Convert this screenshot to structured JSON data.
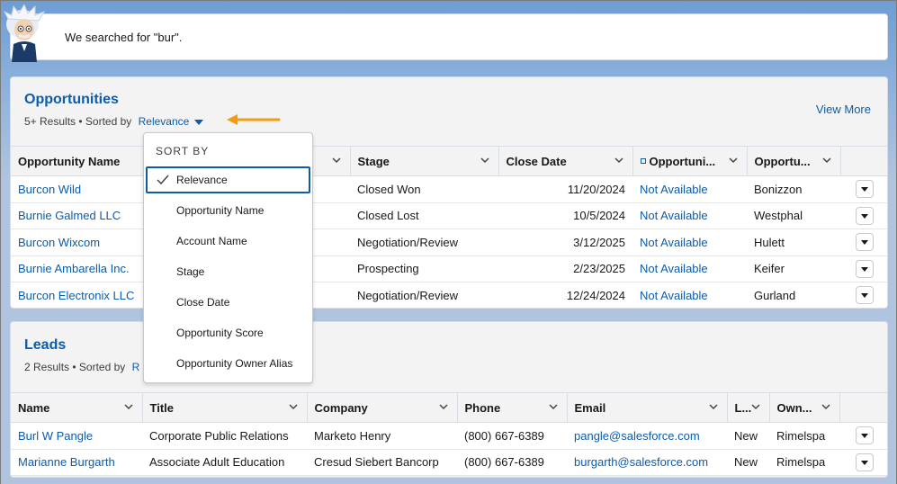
{
  "banner": {
    "text": "We searched for \"bur\"."
  },
  "opportunities": {
    "title": "Opportunities",
    "meta_prefix": "5+ Results • Sorted by",
    "sort_value": "Relevance",
    "view_more": "View More",
    "columns": [
      "Opportunity Name",
      "",
      "Stage",
      "Close Date",
      "Opportuni...",
      "Opportu..."
    ],
    "rows": [
      {
        "name": "Burcon Wild",
        "stage": "Closed Won",
        "close_date": "11/20/2024",
        "score": "Not Available",
        "owner": "Bonizzon"
      },
      {
        "name": "Burnie Galmed LLC",
        "stage": "Closed Lost",
        "close_date": "10/5/2024",
        "score": "Not Available",
        "owner": "Westphal"
      },
      {
        "name": "Burcon Wixcom",
        "stage": "Negotiation/Review",
        "close_date": "3/12/2025",
        "score": "Not Available",
        "owner": "Hulett"
      },
      {
        "name": "Burnie Ambarella Inc.",
        "stage": "Prospecting",
        "close_date": "2/23/2025",
        "score": "Not Available",
        "owner": "Keifer"
      },
      {
        "name": "Burcon Electronix LLC",
        "stage": "Negotiation/Review",
        "close_date": "12/24/2024",
        "score": "Not Available",
        "owner": "Gurland"
      }
    ]
  },
  "leads": {
    "title": "Leads",
    "meta_prefix": "2 Results • Sorted by",
    "sort_value": "R",
    "columns": [
      "Name",
      "Title",
      "Company",
      "Phone",
      "Email",
      "L...",
      "Own..."
    ],
    "rows": [
      {
        "name": "Burl W Pangle",
        "title": "Corporate Public Relations",
        "company": "Marketo Henry",
        "phone": "(800) 667-6389",
        "email": "pangle@salesforce.com",
        "status": "New",
        "owner": "Rimelspa"
      },
      {
        "name": "Marianne Burgarth",
        "title": "Associate Adult Education",
        "company": "Cresud Siebert Bancorp",
        "phone": "(800) 667-6389",
        "email": "burgarth@salesforce.com",
        "status": "New",
        "owner": "Rimelspa"
      }
    ]
  },
  "sort_menu": {
    "heading": "SORT BY",
    "items": [
      "Relevance",
      "Opportunity Name",
      "Account Name",
      "Stage",
      "Close Date",
      "Opportunity Score",
      "Opportunity Owner Alias"
    ],
    "selected_index": 0
  },
  "colors": {
    "link": "#0b5cab",
    "accent_arrow": "#f39c12"
  }
}
